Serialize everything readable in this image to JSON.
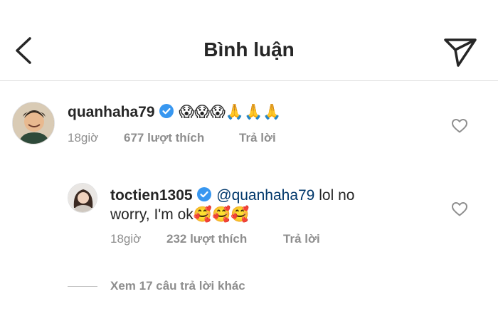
{
  "header": {
    "title": "Bình luận"
  },
  "comments": [
    {
      "username": "quanhaha79",
      "emojis": "😱😱😱🙏🙏🙏",
      "time": "18giờ",
      "likes": "677 lượt thích",
      "reply": "Trả lời"
    }
  ],
  "reply": {
    "username": "toctien1305",
    "mention": "@quanhaha79",
    "text_line1": "lol no",
    "text_line2": "worry, I'm ok",
    "emojis": "🥰🥰🥰",
    "time": "18giờ",
    "likes": "232 lượt thích",
    "reply": "Trả lời"
  },
  "view_more": "Xem 17 câu trả lời khác",
  "colors": {
    "verified": "#3897f0",
    "mention": "#00376b",
    "meta": "#8e8e8e"
  },
  "icons": [
    "back-icon",
    "send-icon",
    "verified-icon",
    "heart-icon"
  ]
}
